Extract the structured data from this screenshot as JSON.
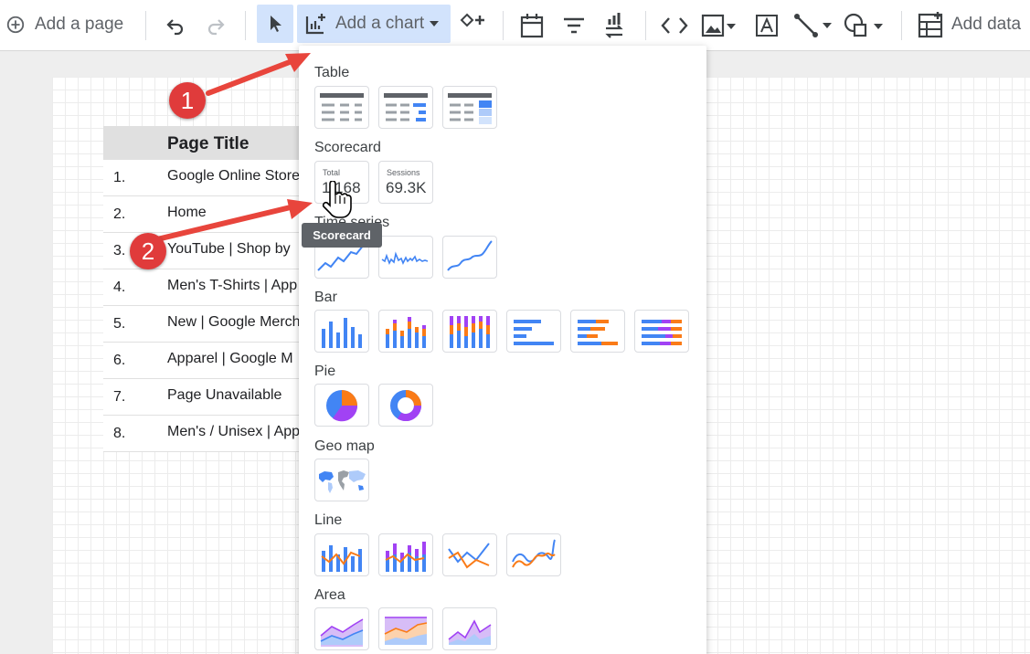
{
  "toolbar": {
    "add_page": "Add a page",
    "add_chart": "Add a chart",
    "add_data": "Add data"
  },
  "table": {
    "header": "Page Title",
    "rows": [
      {
        "num": "1.",
        "title": "Google Online Store"
      },
      {
        "num": "2.",
        "title": "Home"
      },
      {
        "num": "3.",
        "title": "YouTube | Shop by"
      },
      {
        "num": "4.",
        "title": "Men's T-Shirts | App"
      },
      {
        "num": "5.",
        "title": "New | Google Merch"
      },
      {
        "num": "6.",
        "title": "Apparel | Google M"
      },
      {
        "num": "7.",
        "title": "Page Unavailable"
      },
      {
        "num": "8.",
        "title": "Men's / Unisex | App"
      }
    ]
  },
  "menu": {
    "sections": {
      "table": "Table",
      "scorecard": "Scorecard",
      "time_series": "Time series",
      "bar": "Bar",
      "pie": "Pie",
      "geo_map": "Geo map",
      "line": "Line",
      "area": "Area"
    },
    "scorecards": [
      {
        "label": "Total",
        "value": "1,168"
      },
      {
        "label": "Sessions",
        "value": "69.3K"
      }
    ]
  },
  "tooltip": "Scorecard",
  "annotations": {
    "step1": "1",
    "step2": "2"
  },
  "colors": {
    "blue": "#4285f4",
    "orange": "#fa7b17",
    "purple": "#a142f4",
    "annotation_red": "#e03b3b",
    "highlight": "#d2e3fc"
  },
  "icons": [
    "add-circle-icon",
    "undo-icon",
    "redo-icon",
    "pointer-icon",
    "add-chart-icon",
    "dropdown-icon",
    "add-control-icon",
    "calendar-icon",
    "filter-icon",
    "sort-icon",
    "code-icon",
    "image-icon",
    "text-icon",
    "line-icon",
    "shape-icon",
    "add-data-icon",
    "hand-cursor-icon"
  ]
}
